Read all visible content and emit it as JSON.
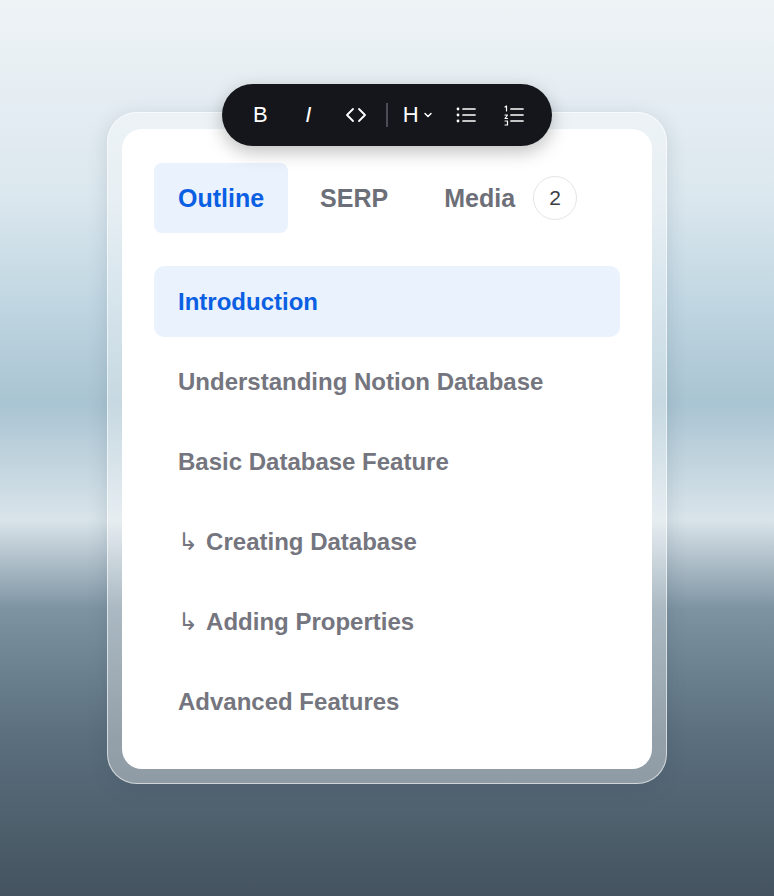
{
  "toolbar": {
    "buttons": [
      {
        "kind": "text",
        "label": "B",
        "style": "bold"
      },
      {
        "kind": "text",
        "label": "I",
        "style": "italic"
      },
      {
        "kind": "code"
      },
      {
        "kind": "separator"
      },
      {
        "kind": "heading",
        "label": "H"
      },
      {
        "kind": "bullet-list"
      },
      {
        "kind": "numbered-list"
      }
    ]
  },
  "tabs": [
    {
      "label": "Outline",
      "selected": true
    },
    {
      "label": "SERP",
      "selected": false
    },
    {
      "label": "Media",
      "selected": false,
      "badge": "2"
    }
  ],
  "outline": [
    {
      "label": "Introduction",
      "selected": true,
      "marker": ""
    },
    {
      "label": "Understanding Notion Database",
      "selected": false,
      "marker": ""
    },
    {
      "label": "Basic Database Feature",
      "selected": false,
      "marker": ""
    },
    {
      "label": "Creating Database",
      "selected": false,
      "marker": "↳"
    },
    {
      "label": "Adding Properties",
      "selected": false,
      "marker": "↳"
    },
    {
      "label": "Advanced Features",
      "selected": false,
      "marker": ""
    }
  ]
}
